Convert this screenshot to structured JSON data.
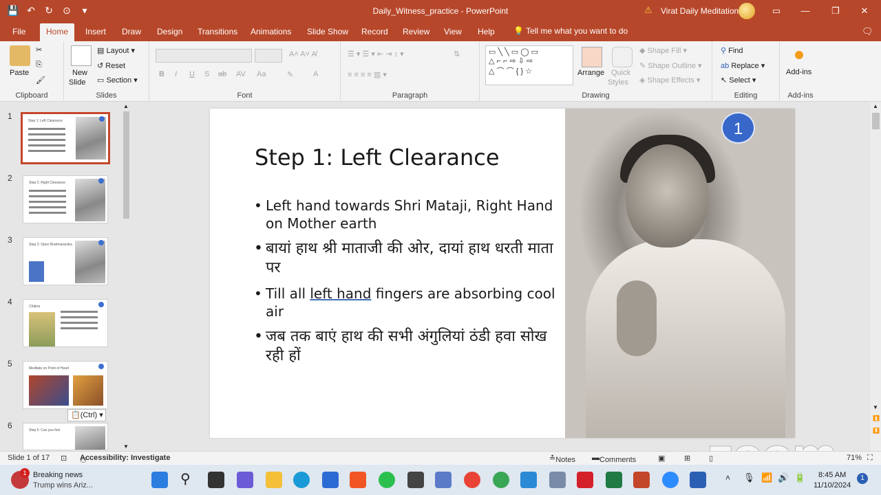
{
  "window": {
    "doc_title": "Daily_Witness_practice  -  PowerPoint",
    "user_name": "Virat Daily Meditation"
  },
  "tabs": [
    "File",
    "Home",
    "Insert",
    "Draw",
    "Design",
    "Transitions",
    "Animations",
    "Slide Show",
    "Record",
    "Review",
    "View",
    "Help"
  ],
  "active_tab": "Home",
  "tell_me": "Tell me what you want to do",
  "ribbon": {
    "clipboard": {
      "paste": "Paste",
      "label": "Clipboard"
    },
    "slides": {
      "new_slide": "New",
      "new_slide2": "Slide",
      "layout": "Layout",
      "reset": "Reset",
      "section": "Section",
      "label": "Slides"
    },
    "font": {
      "label": "Font"
    },
    "paragraph": {
      "label": "Paragraph"
    },
    "drawing": {
      "arrange": "Arrange",
      "quick_styles": "Quick",
      "quick_styles2": "Styles",
      "shape_fill": "Shape Fill",
      "shape_outline": "Shape Outline",
      "shape_effects": "Shape Effects",
      "label": "Drawing"
    },
    "editing": {
      "find": "Find",
      "replace": "Replace",
      "select": "Select",
      "label": "Editing"
    },
    "addins": {
      "button": "Add-ins",
      "label": "Add-ins"
    }
  },
  "thumbnails": [
    {
      "num": "1",
      "title": "Step 1: Left Clearance"
    },
    {
      "num": "2",
      "title": "Step 2: Right Clearance"
    },
    {
      "num": "3",
      "title": "Step 3: Open Brahmarandra"
    },
    {
      "num": "4",
      "title": "Chakra"
    },
    {
      "num": "5",
      "title": "Meditate on Point of Heart"
    },
    {
      "num": "6",
      "title": "Step 5: Can you feel"
    }
  ],
  "ctrl_popup": "(Ctrl)",
  "slide": {
    "title": "Step 1: Left Clearance",
    "badge": "1",
    "bullets": {
      "b1": "Left hand towards Shri Mataji, Right Hand on Mother earth",
      "b2": "बायां हाथ श्री माताजी की ओर, दायां हाथ धरती माता पर",
      "b3_pre": "Till all ",
      "b3_link": "left hand",
      "b3_post": " fingers are absorbing cool air",
      "b4": "जब तक बाएं हाथ की सभी अंगुलियां ठंडी हवा सोख रही हों"
    }
  },
  "status": {
    "slide_of": "Slide 1 of 17",
    "accessibility": "Accessibility: Investigate",
    "notes": "Notes",
    "comments": "Comments",
    "zoom": "71%"
  },
  "watermark": "zoom",
  "taskbar": {
    "news_title": "Breaking news",
    "news_sub": "Trump wins Ariz...",
    "news_count": "1",
    "time": "8:45 AM",
    "date": "11/10/2024",
    "notif": "1"
  }
}
